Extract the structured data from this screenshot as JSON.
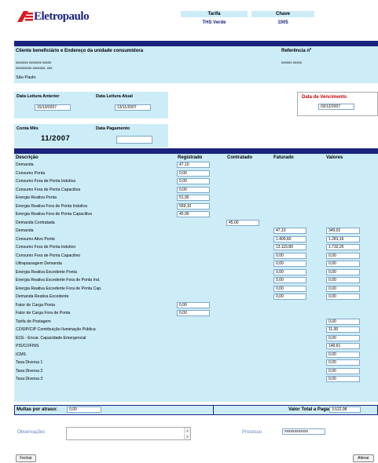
{
  "header": {
    "brand": "Eletropaulo",
    "tarifa_label": "Tarifa",
    "chave_label": "Chave",
    "tarifa_value": "THS Verde",
    "chave_value": "1005"
  },
  "cliente": {
    "section_title": "Cliente beneficiário e Endereço da unidade consumidora",
    "referencia_label": "Referência nº",
    "line1": "xxxxxxx xxxxxxx xxxxx",
    "line2": "xxxxxxxxx xxxxxxx, xxx",
    "line3": "São Paulo",
    "referencia_value": "xxxxxx xxxxx"
  },
  "leituras": {
    "anterior_label": "Data Leitura Anterior",
    "anterior_value": "15/10/2007",
    "atual_label": "Data Leitura Atual",
    "atual_value": "13/11/2007",
    "vencimento_label": "Data de Vencimento",
    "vencimento_value": "03/12/2007"
  },
  "conta": {
    "mes_label": "Conta Mês",
    "mes_value": "11/2007",
    "pagamento_label": "Data Pagamento",
    "pagamento_value": ""
  },
  "table": {
    "headers": {
      "descricao": "Descrição",
      "registrado": "Registrado",
      "contratado": "Contratado",
      "faturado": "Faturado",
      "valores": "Valores"
    },
    "rows": [
      {
        "label": "Demanda",
        "registrado": "47,10"
      },
      {
        "label": "Consumo Ponta",
        "registrado": "0,00"
      },
      {
        "label": "Consumo Fora de Ponta Indutiva",
        "registrado": "0,00"
      },
      {
        "label": "Consumo Fora de Ponta Capacitiva",
        "registrado": "0,00"
      },
      {
        "label": "Energia Reativa Ponta",
        "registrado": "51,90"
      },
      {
        "label": "Energia Reativa Fora de Ponta Indutiva",
        "registrado": "569,10"
      },
      {
        "label": "Energia Reativa Fora de Ponta Capacitiva",
        "registrado": "45,90"
      },
      {
        "label": "Demanda Contratada",
        "contratado": "45,00"
      },
      {
        "label": "Demanda",
        "faturado": "47,10",
        "valores": "349,01"
      },
      {
        "label": "Consumo Ativo Ponte",
        "faturado": "1.400,60",
        "valores": "1.281,16"
      },
      {
        "label": "Consumo Fora de Ponta Indutivo",
        "faturado": "13.115,80",
        "valores": "1.732,20"
      },
      {
        "label": "Consumo Fora de Ponta Capacitivo",
        "faturado": "0,00",
        "valores": "0,00"
      },
      {
        "label": "Ultrapassagem Demanda",
        "faturado": "0,00",
        "valores": "0,00"
      },
      {
        "label": "Energia Reativa Excedente Ponta",
        "faturado": "0,00",
        "valores": "0,00"
      },
      {
        "label": "Energia Reativa Excedente Fora de Ponta Ind.",
        "faturado": "0,00",
        "valores": "0,00"
      },
      {
        "label": "Energia Reativa Excedente Fora de Ponta Cap.",
        "faturado": "0,00",
        "valores": "0,00"
      },
      {
        "label": "Demanda Reativa Excedente",
        "faturado": "0,00",
        "valores": "0,00"
      },
      {
        "label": "Fator de Carga Ponta",
        "registrado": "0,00"
      },
      {
        "label": "Fator de Carga Fora de Ponta",
        "registrado": "0,00"
      },
      {
        "label": "Tarifa de Postagem",
        "valores": "0,00"
      },
      {
        "label": "COSIP/CIP Contribuição Iluminação Pública",
        "valores": "11,00"
      },
      {
        "label": "ECE - Encar. Capacidade Emergencial",
        "valores": "0,00"
      },
      {
        "label": "PIS/COFINS",
        "valores": "149,61"
      },
      {
        "label": "ICMS",
        "valores": "0,00"
      },
      {
        "label": "Taxa Diversa 1",
        "valores": "0,00"
      },
      {
        "label": "Taxa Diversa 2",
        "valores": "0,00"
      },
      {
        "label": "Taxa Diversa 3",
        "valores": "0,00"
      }
    ]
  },
  "totals": {
    "multas_label": "Multas por atraso:",
    "multas_value": "0,00",
    "total_label": "Valor Total a Pagar:",
    "total_value": "3.522,98"
  },
  "footer": {
    "observacoes_label": "Observações",
    "processo_label": "Processo",
    "processo_value": "xxxxxxxxxxxx",
    "fechar_label": "Fechar",
    "alterar_label": "Alterar"
  },
  "colors": {
    "navy": "#1a237e",
    "light_blue": "#ccecf8",
    "brand_red": "#d71920",
    "due_red": "#cc0000"
  }
}
